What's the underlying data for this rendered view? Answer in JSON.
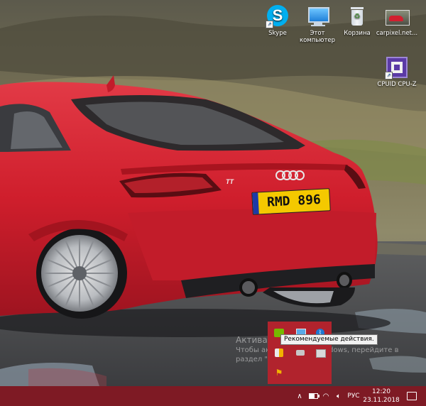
{
  "desktop": {
    "icons": [
      {
        "label": "Skype"
      },
      {
        "label": "Этот компьютер"
      },
      {
        "label": "Корзина"
      },
      {
        "label": "carpixel.net..."
      },
      {
        "label": "CPUID CPU-Z"
      }
    ],
    "car_plate": "RMD 896",
    "car_badge": "TT"
  },
  "activation": {
    "line1": "Активация Windows",
    "line2": "Чтобы активировать Windows, перейдите в раздел \"Параметры\"."
  },
  "tray_flyout": {
    "tooltip": "Рекомендуемые действия."
  },
  "taskbar": {
    "language": "РУС",
    "time": "12:20",
    "date": "23.11.2018"
  },
  "colors": {
    "taskbar": "#7e1a24",
    "flyout": "#b1232d",
    "car_red": "#d2202f"
  }
}
